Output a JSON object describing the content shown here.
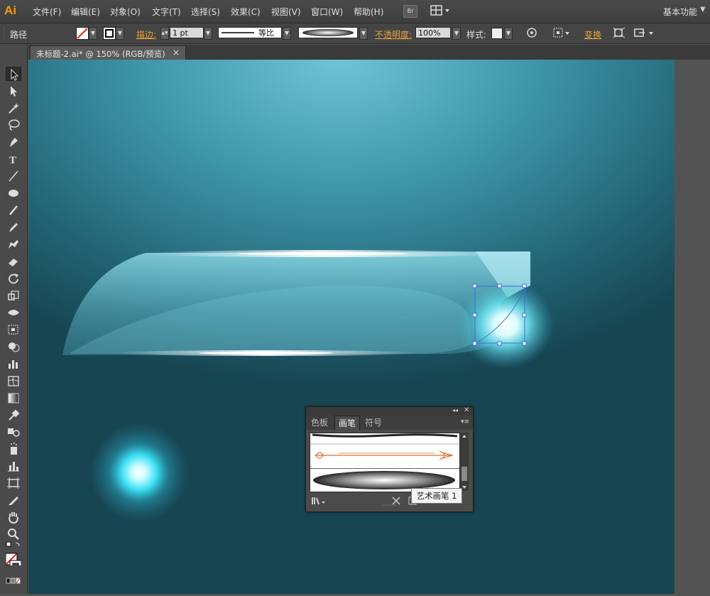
{
  "app": {
    "logo": "Ai",
    "workspace": "基本功能"
  },
  "menu": {
    "items": [
      "文件(F)",
      "编辑(E)",
      "对象(O)",
      "文字(T)",
      "选择(S)",
      "效果(C)",
      "视图(V)",
      "窗口(W)",
      "帮助(H)"
    ],
    "bridge_label": "Br"
  },
  "control": {
    "selection_type": "路径",
    "stroke_label": "描边:",
    "stroke_weight": "1 pt",
    "profile_label": "等比",
    "opacity_label": "不透明度:",
    "opacity_value": "100%",
    "style_label": "样式:",
    "transform_label": "变换"
  },
  "document": {
    "tab_title": "未标题-2.ai* @ 150% (RGB/预览)",
    "close": "×"
  },
  "brush_panel": {
    "tabs": [
      "色板",
      "画笔",
      "符号"
    ],
    "active_tab": "画笔",
    "tooltip": "艺术画笔 1"
  },
  "colors": {
    "accent_orange": "#ff9a00",
    "canvas_top": "#6fc3d6",
    "canvas_bottom": "#174552",
    "selection_blue": "#3a6fd8"
  }
}
